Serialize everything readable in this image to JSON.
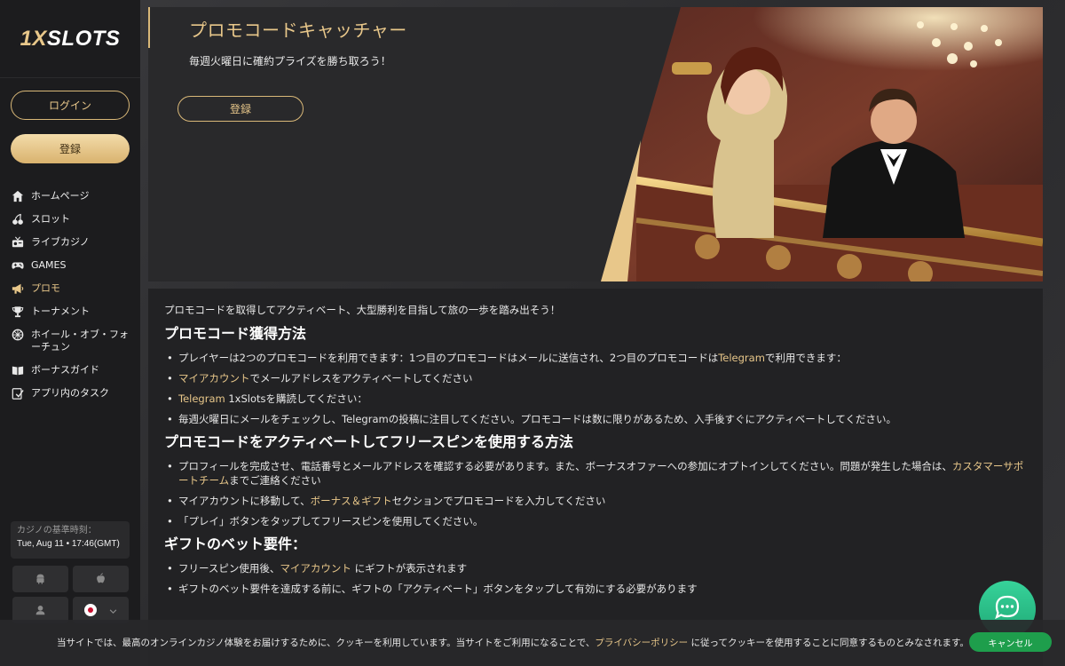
{
  "brand": {
    "logo_gold": "1X",
    "logo_white": "SLOTS"
  },
  "auth": {
    "login_label": "ログイン",
    "register_label": "登録"
  },
  "nav": {
    "items": [
      {
        "label": "ホームページ",
        "icon": "home-icon",
        "active": false
      },
      {
        "label": "スロット",
        "icon": "cherry-icon",
        "active": false
      },
      {
        "label": "ライブカジノ",
        "icon": "live-casino-icon",
        "active": false
      },
      {
        "label": "GAMES",
        "icon": "gamepad-icon",
        "active": false
      },
      {
        "label": "プロモ",
        "icon": "megaphone-icon",
        "active": true
      },
      {
        "label": "トーナメント",
        "icon": "trophy-icon",
        "active": false
      },
      {
        "label": "ホイール・オブ・フォーチュン",
        "icon": "wheel-icon",
        "active": false
      },
      {
        "label": "ボーナスガイド",
        "icon": "book-icon",
        "active": false
      },
      {
        "label": "アプリ内のタスク",
        "icon": "task-icon",
        "active": false
      }
    ]
  },
  "casino_time": {
    "label": "カジノの基準時刻：",
    "value": "Tue, Aug 11 • 17:46(GMT)"
  },
  "hero": {
    "title": "プロモコードキャッチャー",
    "subtitle": "毎週火曜日に確約プライズを勝ち取ろう！",
    "button_label": "登録"
  },
  "content": {
    "intro": "プロモコードを取得してアクティベート、大型勝利を目指して旅の一歩を踏み出そう！",
    "section1": {
      "heading": "プロモコード獲得方法",
      "item1_a": "プレイヤーは2つのプロモコードを利用できます：1つ目のプロモコードはメールに送信され、2つ目のプロモコードは",
      "item1_link": "Telegram",
      "item1_b": "で利用できます：",
      "item2_link": "マイアカウント",
      "item2_b": "でメールアドレスをアクティベートしてください",
      "item3_link": "Telegram",
      "item3_b": " 1xSlotsを購読してください：",
      "item4": "毎週火曜日にメールをチェックし、Telegramの投稿に注目してください。プロモコードは数に限りがあるため、入手後すぐにアクティベートしてください。"
    },
    "section2": {
      "heading": "プロモコードをアクティベートしてフリースピンを使用する方法",
      "item1_a": "プロフィールを完成させ、電話番号とメールアドレスを確認する必要があります。また、ボーナスオファーへの参加にオプトインしてください。問題が発生した場合は、",
      "item1_link": "カスタマーサポートチーム",
      "item1_b": "までご連絡ください",
      "item2_a": "マイアカウントに移動して、",
      "item2_link": "ボーナス＆ギフト",
      "item2_b": "セクションでプロモコードを入力してください",
      "item3": "「プレイ」ボタンをタップしてフリースピンを使用してください。"
    },
    "section3": {
      "heading": "ギフトのベット要件：",
      "item1_a": "フリースピン使用後、",
      "item1_link": "マイアカウント",
      "item1_b": " にギフトが表示されます",
      "item2": "ギフトのベット要件を達成する前に、ギフトの「アクティベート」ボタンをタップして有効にする必要があります"
    }
  },
  "cookie": {
    "text_a": "当サイトでは、最高のオンラインカジノ体験をお届けするために、クッキーを利用しています。当サイトをご利用になることで、",
    "link": "プライバシーポリシー",
    "text_b": " に従ってクッキーを使用することに同意するものとみなされます。",
    "button_label": "キャンセル"
  },
  "colors": {
    "accent": "#e8c78a",
    "chat": "#2bc48a",
    "cookie_button": "#1e9e4c"
  }
}
